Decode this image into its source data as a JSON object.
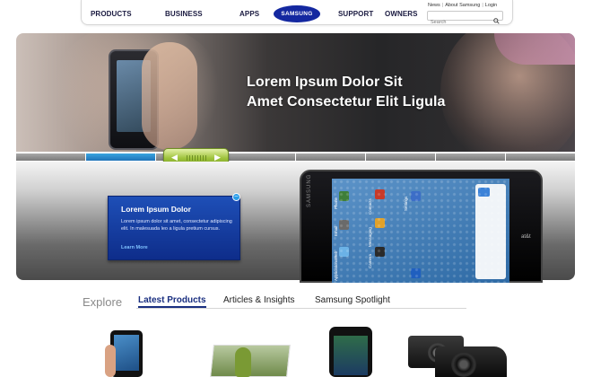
{
  "header": {
    "nav": [
      "PRODUCTS",
      "BUSINESS",
      "APPS",
      "SUPPORT",
      "OWNERS"
    ],
    "logo": "SAMSUNG",
    "utility": {
      "news": "News",
      "about": "About Samsung",
      "login": "Login"
    },
    "search_placeholder": "Search"
  },
  "hero": {
    "title_line1": "Lorem Ipsum Dolor Sit",
    "title_line2": "Amet Consectetur Elit Ligula"
  },
  "slider": {
    "segments": 8,
    "active_index": 1
  },
  "promo": {
    "title": "Lorem Ipsum Dolor",
    "body": "Lorem ipsum dolor sit amet, consectetur adipiscing elit. In malesuada leo a ligula pretium cursus.",
    "link": "Learn More"
  },
  "phone": {
    "brand": "SAMSUNG",
    "carrier": "at&t",
    "apps": [
      "Phone",
      "Contacts",
      "Settings",
      "Email",
      "Messaging",
      "Web",
      "Camera",
      "Applications"
    ]
  },
  "tabs": {
    "explore": "Explore",
    "items": [
      "Latest Products",
      "Articles & Insights",
      "Samsung Spotlight"
    ],
    "active": 0
  },
  "colors": {
    "brand_blue": "#1428a0",
    "accent_green": "#9dc23a",
    "active_segment": "#2a8fd3"
  }
}
